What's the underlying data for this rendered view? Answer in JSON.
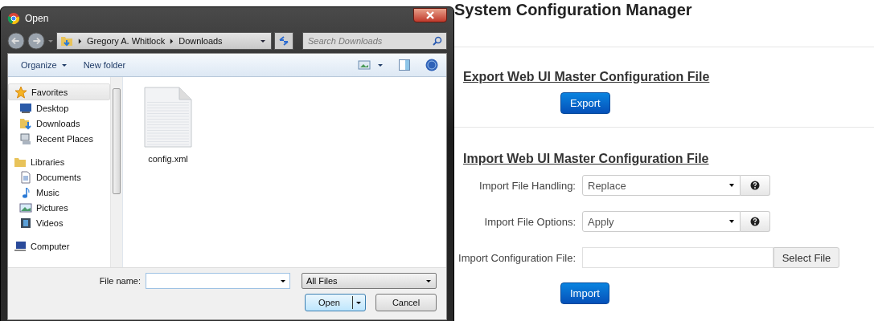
{
  "dialog": {
    "title": "Open",
    "breadcrumb": [
      "Gregory A. Whitlock",
      "Downloads"
    ],
    "search": {
      "placeholder": "Search Downloads"
    },
    "toolbar": [
      {
        "label": "Organize",
        "kind": "menu"
      },
      {
        "label": "New folder",
        "kind": "button"
      }
    ],
    "nav": [
      {
        "label": "Favorites",
        "kind": "star",
        "selected": true,
        "children": [
          {
            "label": "Desktop",
            "kind": "desktop",
            "selected": false
          },
          {
            "label": "Downloads",
            "kind": "download",
            "selected": false
          },
          {
            "label": "Recent Places",
            "kind": "recent",
            "selected": false
          }
        ]
      },
      {
        "label": "Libraries",
        "kind": "library",
        "selected": false,
        "children": [
          {
            "label": "Documents",
            "kind": "document",
            "selected": false
          },
          {
            "label": "Music",
            "kind": "music",
            "selected": false
          },
          {
            "label": "Pictures",
            "kind": "pictures",
            "selected": false
          },
          {
            "label": "Videos",
            "kind": "videos",
            "selected": false
          }
        ]
      },
      {
        "label": "Computer",
        "kind": "computer",
        "selected": false
      }
    ],
    "files": [
      {
        "name": "config.xml"
      }
    ],
    "file_name": {
      "label": "File name:"
    },
    "file_type": "All Files",
    "buttons": [
      {
        "label": "Open",
        "kind": "split"
      },
      {
        "label": "Cancel",
        "kind": "plain"
      }
    ]
  },
  "page": {
    "title": "System Configuration Manager",
    "sections": [
      {
        "heading": "Export Web UI Master Configuration File",
        "button": "Export"
      },
      {
        "heading": "Import Web UI Master Configuration File",
        "fields": [
          {
            "kind": "select",
            "label": "Import File Handling:",
            "value": "Replace"
          },
          {
            "kind": "select",
            "label": "Import File Options:",
            "value": "Apply"
          },
          {
            "kind": "file",
            "label": "Import Configuration File:",
            "button": "Select File"
          }
        ],
        "button": "Import"
      }
    ]
  }
}
